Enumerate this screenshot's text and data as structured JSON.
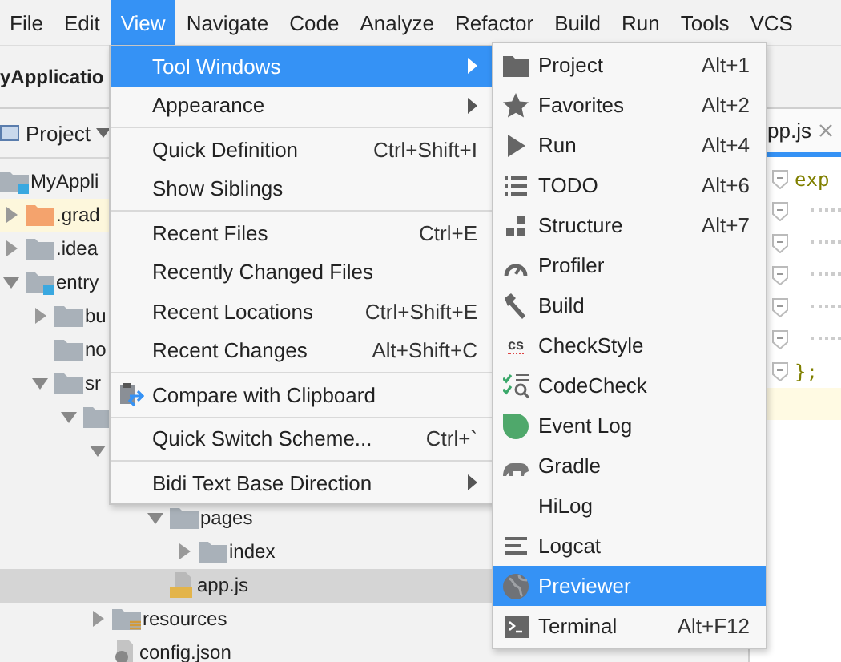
{
  "menubar": [
    {
      "label": "File",
      "selected": false
    },
    {
      "label": "Edit",
      "selected": false
    },
    {
      "label": "View",
      "selected": true
    },
    {
      "label": "Navigate",
      "selected": false
    },
    {
      "label": "Code",
      "selected": false
    },
    {
      "label": "Analyze",
      "selected": false
    },
    {
      "label": "Refactor",
      "selected": false
    },
    {
      "label": "Build",
      "selected": false
    },
    {
      "label": "Run",
      "selected": false
    },
    {
      "label": "Tools",
      "selected": false
    },
    {
      "label": "VCS",
      "selected": false
    }
  ],
  "navbar": {
    "title": "yApplicatio"
  },
  "project_panel": {
    "view_selector": "Project",
    "tree": [
      {
        "label": "MyAppli",
        "kind": "module",
        "selected": false,
        "children": [
          {
            "label": ".grad",
            "kind": "excluded",
            "expanded": false,
            "selected": false
          },
          {
            "label": ".idea",
            "kind": "folder",
            "expanded": false,
            "selected": false
          },
          {
            "label": "entry",
            "kind": "module",
            "expanded": true,
            "selected": false,
            "children": [
              {
                "label": "bu",
                "kind": "folder",
                "expanded": false,
                "selected": false
              },
              {
                "label": "no",
                "kind": "folder",
                "selected": false
              },
              {
                "label": "sr",
                "kind": "folder",
                "expanded": true,
                "selected": false,
                "children": [
                  {
                    "kind": "folder",
                    "expanded": true,
                    "selected": false,
                    "children": [
                      {
                        "expanded": true,
                        "selected": false,
                        "children": [
                          {
                            "children": [
                              {
                                "label": "pages",
                                "kind": "folder",
                                "expanded": true,
                                "selected": false,
                                "children": [
                                  {
                                    "label": "index",
                                    "kind": "folder",
                                    "expanded": false,
                                    "selected": false
                                  }
                                ]
                              },
                              {
                                "label": "app.js",
                                "kind": "js",
                                "selected": true
                              }
                            ]
                          }
                        ]
                      },
                      {
                        "label": "resources",
                        "kind": "resources",
                        "expanded": false,
                        "selected": false
                      },
                      {
                        "label": "config.json",
                        "kind": "json",
                        "selected": false
                      }
                    ]
                  }
                ]
              }
            ]
          }
        ]
      }
    ]
  },
  "editor": {
    "tabs": [
      {
        "label": "pp.js",
        "selected": true
      }
    ],
    "lines": [
      {
        "kind": "code",
        "text": "exp"
      },
      {
        "kind": "dots"
      },
      {
        "kind": "dots"
      },
      {
        "kind": "dots"
      },
      {
        "kind": "dots"
      },
      {
        "kind": "dots"
      },
      {
        "kind": "code",
        "text": "};"
      },
      {
        "kind": "current"
      }
    ]
  },
  "view_menu": {
    "groups": [
      [
        {
          "label": "Tool Windows",
          "submenu": true,
          "selected": true
        },
        {
          "label": "Appearance",
          "submenu": true,
          "selected": false
        }
      ],
      [
        {
          "label": "Quick Definition",
          "shortcut": "Ctrl+Shift+I",
          "selected": false
        },
        {
          "label": "Show Siblings",
          "selected": false
        }
      ],
      [
        {
          "label": "Recent Files",
          "shortcut": "Ctrl+E",
          "selected": false
        },
        {
          "label": "Recently Changed Files",
          "selected": false
        },
        {
          "label": "Recent Locations",
          "shortcut": "Ctrl+Shift+E",
          "selected": false
        },
        {
          "label": "Recent Changes",
          "shortcut": "Alt+Shift+C",
          "selected": false
        }
      ],
      [
        {
          "label": "Compare with Clipboard",
          "icon": true,
          "selected": false
        }
      ],
      [
        {
          "label": "Quick Switch Scheme...",
          "shortcut": "Ctrl+`",
          "selected": false
        }
      ],
      [
        {
          "label": "Bidi Text Base Direction",
          "submenu": true,
          "selected": false
        }
      ]
    ]
  },
  "tool_windows_menu": [
    {
      "label": "Project",
      "shortcut": "Alt+1",
      "selected": false
    },
    {
      "label": "Favorites",
      "shortcut": "Alt+2",
      "selected": false
    },
    {
      "label": "Run",
      "shortcut": "Alt+4",
      "selected": false
    },
    {
      "label": "TODO",
      "shortcut": "Alt+6",
      "selected": false
    },
    {
      "label": "Structure",
      "shortcut": "Alt+7",
      "selected": false
    },
    {
      "label": "Profiler",
      "selected": false
    },
    {
      "label": "Build",
      "selected": false
    },
    {
      "label": "CheckStyle",
      "badge": "cs",
      "selected": false
    },
    {
      "label": "CodeCheck",
      "selected": false
    },
    {
      "label": "Event Log",
      "selected": false
    },
    {
      "label": "Gradle",
      "selected": false
    },
    {
      "label": "HiLog",
      "selected": false
    },
    {
      "label": "Logcat",
      "selected": false
    },
    {
      "label": "Previewer",
      "selected": true
    },
    {
      "label": "Terminal",
      "shortcut": "Alt+F12",
      "selected": false
    }
  ]
}
